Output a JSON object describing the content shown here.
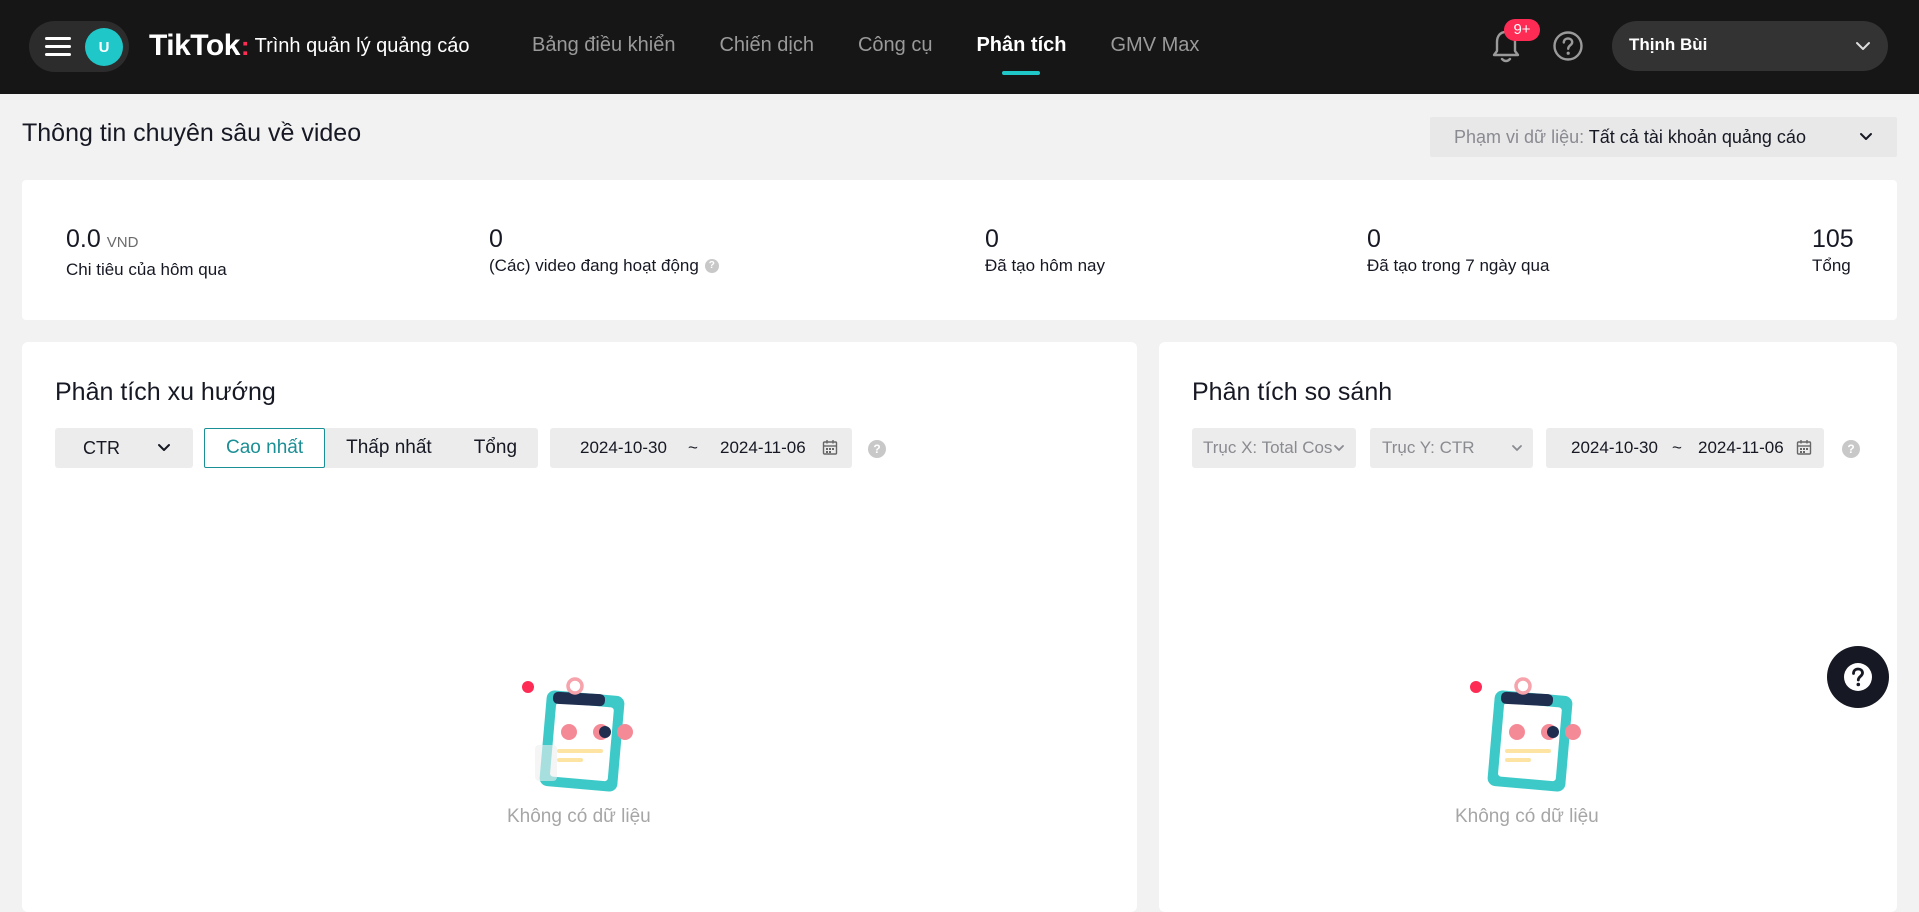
{
  "header": {
    "avatar_initial": "U",
    "brand": "TikTok",
    "brand_subtitle": "Trình quản lý quảng cáo",
    "nav": [
      {
        "label": "Bảng điều khiển",
        "active": false
      },
      {
        "label": "Chiến dịch",
        "active": false
      },
      {
        "label": "Công cụ",
        "active": false
      },
      {
        "label": "Phân tích",
        "active": true
      },
      {
        "label": "GMV Max",
        "active": false
      }
    ],
    "notification_badge": "9+",
    "user_name": "Thịnh Bùi"
  },
  "page": {
    "title": "Thông tin chuyên sâu về video",
    "scope_label": "Phạm vi dữ liệu:",
    "scope_value": "Tất cả tài khoản quảng cáo"
  },
  "stats": [
    {
      "value": "0.0",
      "unit": "VND",
      "label": "Chi tiêu của hôm qua"
    },
    {
      "value": "0",
      "label": "(Các) video đang hoạt động",
      "has_help": true
    },
    {
      "value": "0",
      "label": "Đã tạo hôm nay"
    },
    {
      "value": "0",
      "label": "Đã tạo trong 7 ngày qua"
    },
    {
      "value": "105",
      "label": "Tổng"
    }
  ],
  "trend": {
    "title": "Phân tích xu hướng",
    "metric": "CTR",
    "segments": [
      "Cao nhất",
      "Thấp nhất",
      "Tổng"
    ],
    "active_segment": "Cao nhất",
    "date_start": "2024-10-30",
    "date_sep": "~",
    "date_end": "2024-11-06",
    "empty_text": "Không có dữ liệu"
  },
  "compare": {
    "title": "Phân tích so sánh",
    "x_axis": "Trục X: Total Cos",
    "y_axis": "Trục Y: CTR",
    "date_start": "2024-10-30",
    "date_sep": "~",
    "date_end": "2024-11-06",
    "empty_text": "Không có dữ liệu"
  },
  "colors": {
    "accent": "#20c7c9",
    "brand_red": "#fe2c55",
    "topbar": "#161616"
  },
  "icons": [
    "menu-icon",
    "bell-icon",
    "help-circle-icon",
    "chevron-down-icon",
    "calendar-icon",
    "empty-clipboard-illustration",
    "floating-help-icon"
  ]
}
